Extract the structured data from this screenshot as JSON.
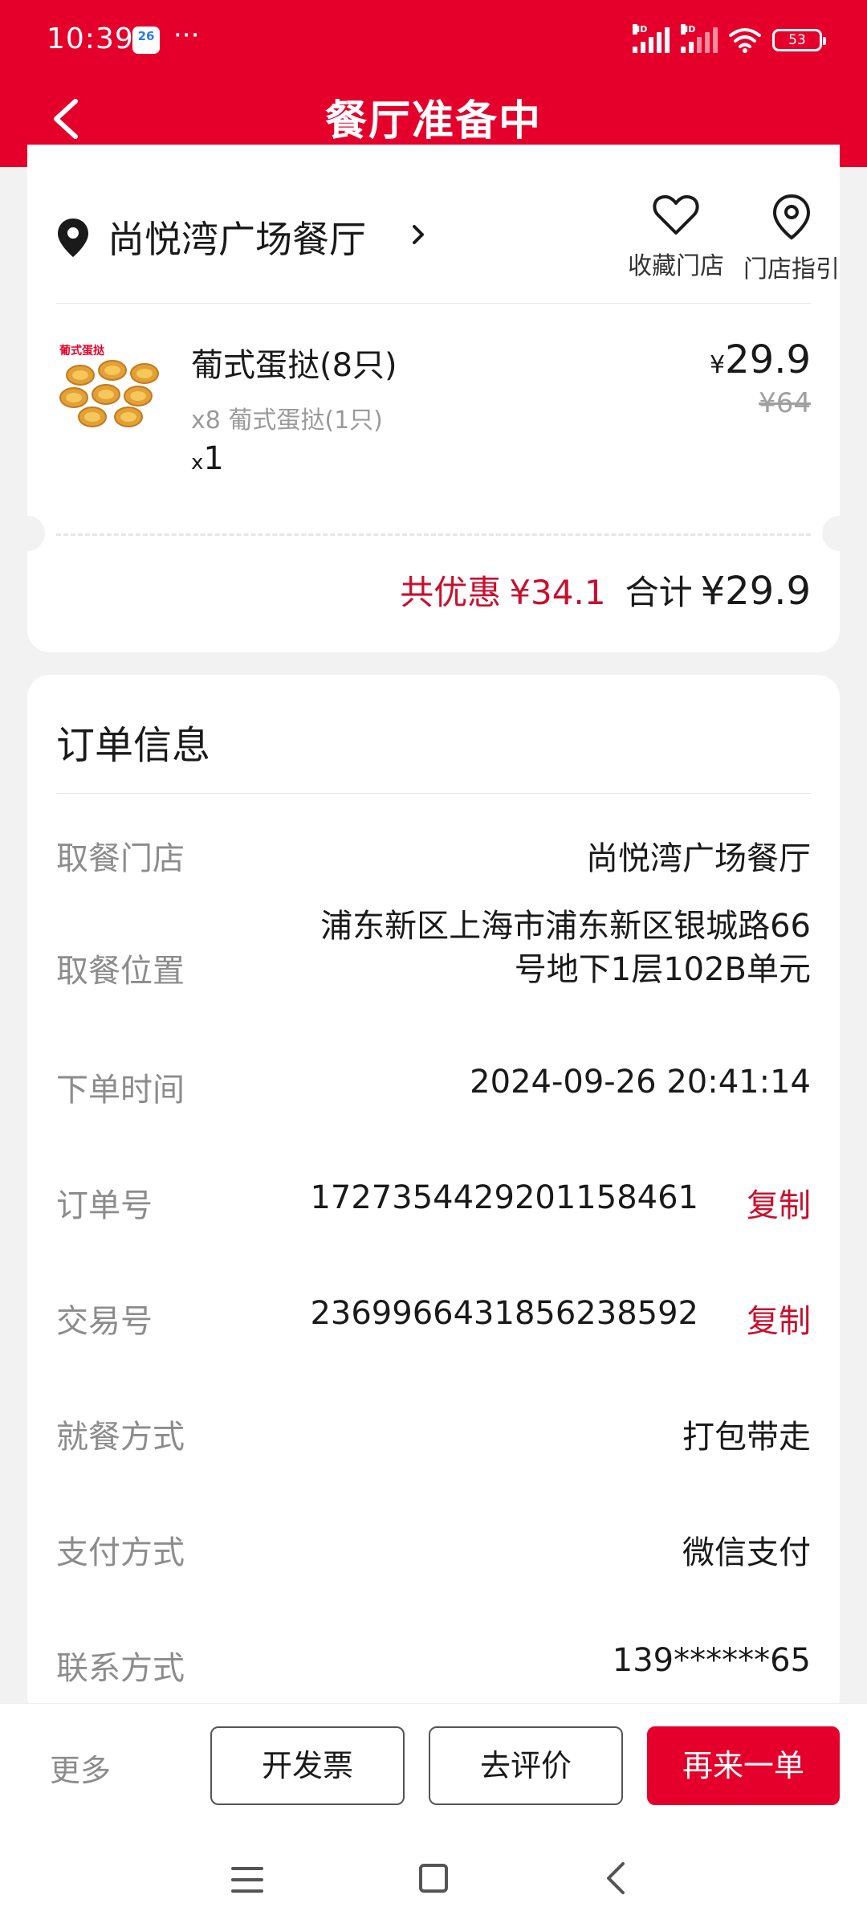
{
  "status_bar": {
    "time": "10:39",
    "calendar_day": "26",
    "more_dots": "···",
    "signal_hd": "HD",
    "battery": "53"
  },
  "header": {
    "title": "餐厅准备中"
  },
  "store": {
    "name": "尚悦湾广场餐厅",
    "favorite_label": "收藏门店",
    "guide_label": "门店指引"
  },
  "product": {
    "name": "葡式蛋挞(8只)",
    "detail": "x8 葡式蛋挞(1只)",
    "qty_prefix": "x",
    "qty": "1",
    "currency": "¥",
    "price": "29.9",
    "original_price": "¥64"
  },
  "totals": {
    "discount_label": "共优惠",
    "discount_value": "¥34.1",
    "total_label": "合计",
    "total_value": "¥29.9"
  },
  "order_info": {
    "title": "订单信息",
    "copy_label": "复制",
    "rows": [
      {
        "label": "取餐门店",
        "value": "尚悦湾广场餐厅"
      },
      {
        "label": "取餐位置",
        "value": "浦东新区上海市浦东新区银城路66号地下1层102B单元"
      },
      {
        "label": "下单时间",
        "value": "2024-09-26 20:41:14"
      },
      {
        "label": "订单号",
        "value": "1727354429201158461"
      },
      {
        "label": "交易号",
        "value": "2369966431856238592"
      },
      {
        "label": "就餐方式",
        "value": "打包带走"
      },
      {
        "label": "支付方式",
        "value": "微信支付"
      },
      {
        "label": "联系方式",
        "value": "139******65"
      }
    ]
  },
  "bottom_bar": {
    "more": "更多",
    "invoice": "开发票",
    "review": "去评价",
    "reorder": "再来一单"
  },
  "colors": {
    "brand_red": "#e4002b",
    "accent_red": "#c8102e"
  }
}
